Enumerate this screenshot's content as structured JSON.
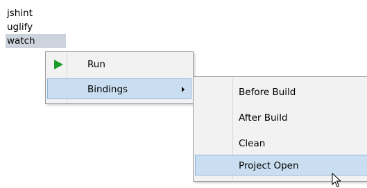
{
  "tasks": [
    "jshint",
    "uglify",
    "watch"
  ],
  "context_menu": {
    "items": [
      {
        "label": "Run",
        "icon": "play-icon"
      },
      {
        "label": "Bindings",
        "has_submenu": true
      }
    ]
  },
  "submenu": {
    "items": [
      "Before Build",
      "After Build",
      "Clean",
      "Project Open"
    ],
    "hovered": "Project Open"
  },
  "colors": {
    "selection": "#cdd3dc",
    "hover": "#c9def0",
    "hover_border": "#8fb7dc",
    "play_icon": "#1f9d2b"
  }
}
